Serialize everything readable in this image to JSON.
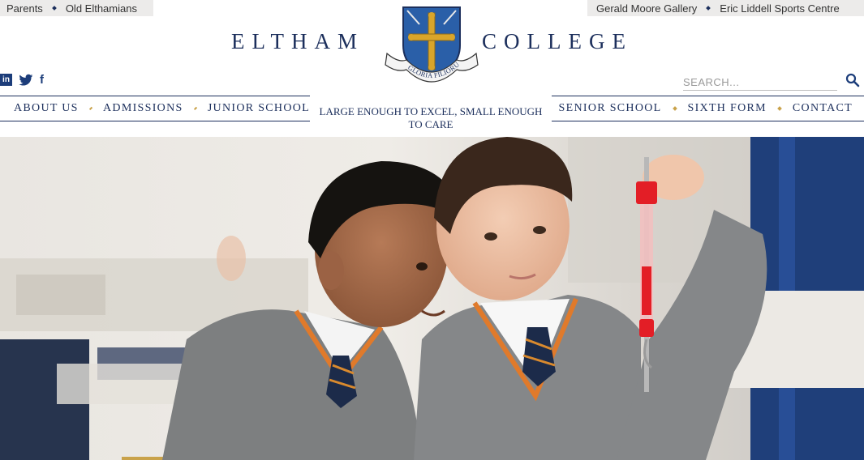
{
  "utility_left": [
    "Parents",
    "Old Elthamians"
  ],
  "utility_right": [
    "Gerald Moore Gallery",
    "Eric Liddell Sports Centre"
  ],
  "brand": {
    "word_left": "ELTHAM",
    "word_right": "COLLEGE",
    "motto": "GLORIA FILIORUM PATRES",
    "crest_icon": "school-crest-icon"
  },
  "social": {
    "linkedin": "in",
    "twitter_icon": "twitter-icon",
    "facebook": "f"
  },
  "search": {
    "placeholder": "SEARCH..."
  },
  "nav_left": [
    "ABOUT US",
    "ADMISSIONS",
    "JUNIOR SCHOOL"
  ],
  "nav_right": [
    "SENIOR SCHOOL",
    "SIXTH FORM",
    "CONTACT"
  ],
  "tagline": "LARGE ENOUGH TO EXCEL, SMALL ENOUGH TO CARE",
  "colors": {
    "navy": "#1c2f5c",
    "gold": "#c9a24a",
    "utility_bg": "#ecebea"
  },
  "hero": {
    "subject": "two pupils in grey uniform examining a red spring balance"
  }
}
